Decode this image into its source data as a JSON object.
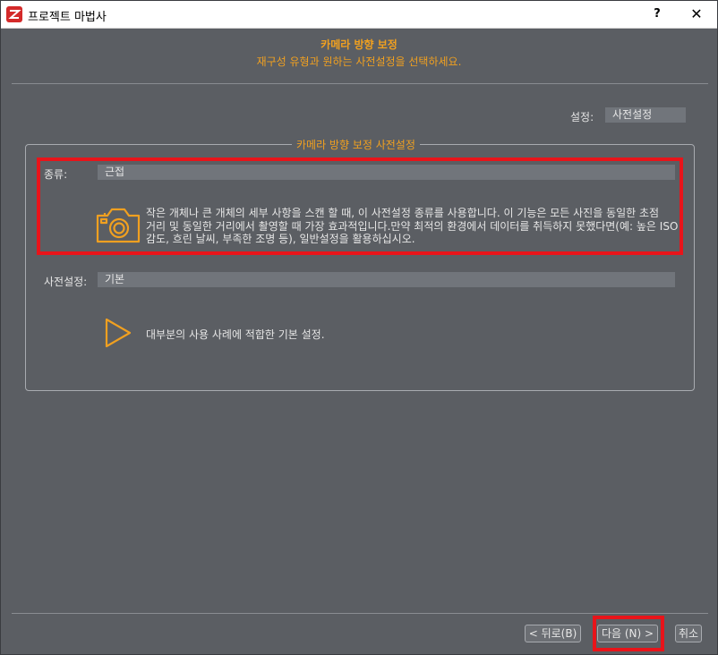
{
  "window": {
    "title": "프로젝트 마법사",
    "help_label": "?",
    "close_label": "✕"
  },
  "header": {
    "title": "카메라 방향 보정",
    "subtitle": "재구성 유형과 원하는 사전설정을 선택하세요."
  },
  "settings": {
    "label": "설정:",
    "value": "사전설정"
  },
  "group": {
    "legend": "카메라 방향 보정 사전설정",
    "type_label": "종류:",
    "type_value": "근접",
    "type_description": "작은 개체나 큰 개체의 세부 사항을 스캔 할 때, 이 사전설정 종류를 사용합니다. 이 기능은 모든 사진을 동일한 초점 거리 및 동일한 거리에서 촬영할 때 가장 효과적입니다.만약 최적의 환경에서 데이터를 취득하지 못했다면(예: 높은 ISO 감도, 흐린 날씨, 부족한 조명 등), 일반설정을 활용하십시오.",
    "type_icon": "camera-icon",
    "preset_label": "사전설정:",
    "preset_value": "기본",
    "preset_description": "대부분의 사용 사례에 적합한 기본 설정.",
    "preset_icon": "play-icon"
  },
  "footer": {
    "back_label": "< 뒤로(B)",
    "next_label": "다음 (N) >",
    "cancel_label": "취소"
  },
  "colors": {
    "accent": "#f0a020",
    "background": "#5b5e63",
    "highlight": "#e8141a"
  }
}
